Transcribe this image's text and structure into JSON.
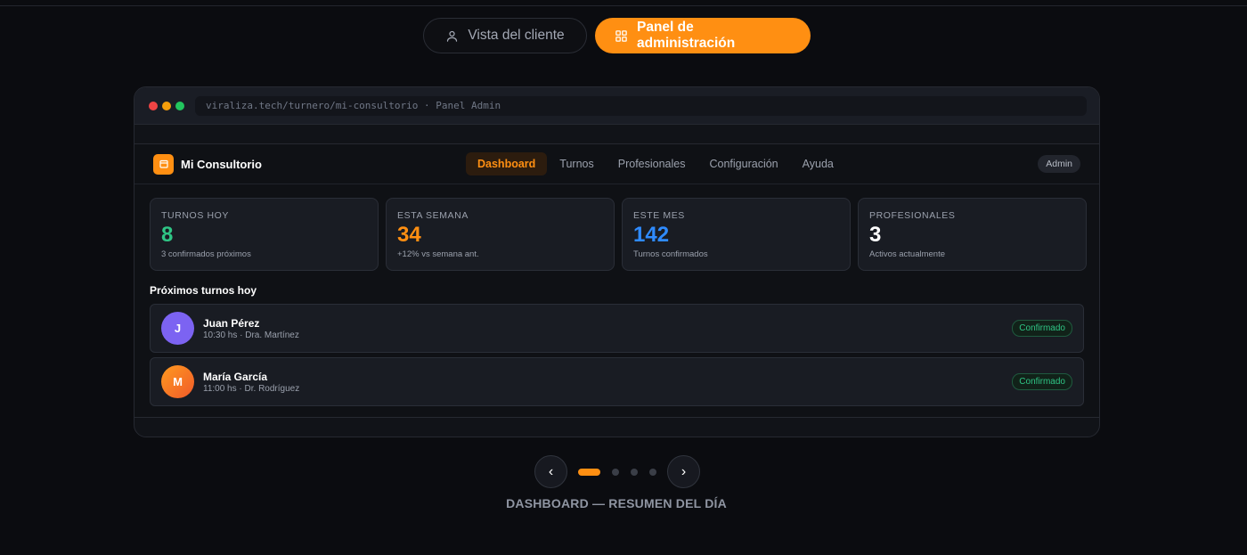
{
  "toggle": {
    "client_label": "Vista del cliente",
    "admin_label": "Panel de administración"
  },
  "browser": {
    "url": "viraliza.tech/turnero/mi-consultorio · Panel Admin",
    "dots": [
      "#ef4444",
      "#f59e0b",
      "#22c55e"
    ]
  },
  "app": {
    "brand": "Mi Consultorio",
    "nav": [
      "Dashboard",
      "Turnos",
      "Profesionales",
      "Configuración",
      "Ayuda"
    ],
    "active_nav": "Dashboard",
    "role_badge": "Admin"
  },
  "stats": [
    {
      "label": "TURNOS HOY",
      "value": "8",
      "sub": "3 confirmados próximos",
      "color": "#2fc585"
    },
    {
      "label": "ESTA SEMANA",
      "value": "34",
      "sub": "+12% vs semana ant.",
      "color": "#ff8f12"
    },
    {
      "label": "ESTE MES",
      "value": "142",
      "sub": "Turnos confirmados",
      "color": "#2f8bff"
    },
    {
      "label": "PROFESIONALES",
      "value": "3",
      "sub": "Activos actualmente",
      "color": "#ffffff"
    }
  ],
  "section_title": "Próximos turnos hoy",
  "appointments": [
    {
      "initial": "J",
      "name": "Juan Pérez",
      "meta": "10:30 hs · Dra. Martínez",
      "status": "Confirmado",
      "avatar_color": "#7c63f2"
    },
    {
      "initial": "M",
      "name": "María García",
      "meta": "11:00 hs · Dr. Rodríguez",
      "status": "Confirmado",
      "avatar_color": "#ff7a1a"
    }
  ],
  "carousel": {
    "prev": "‹",
    "next": "›",
    "slides": 4,
    "active_slide": 1,
    "caption": "DASHBOARD — RESUMEN DEL DÍA"
  }
}
